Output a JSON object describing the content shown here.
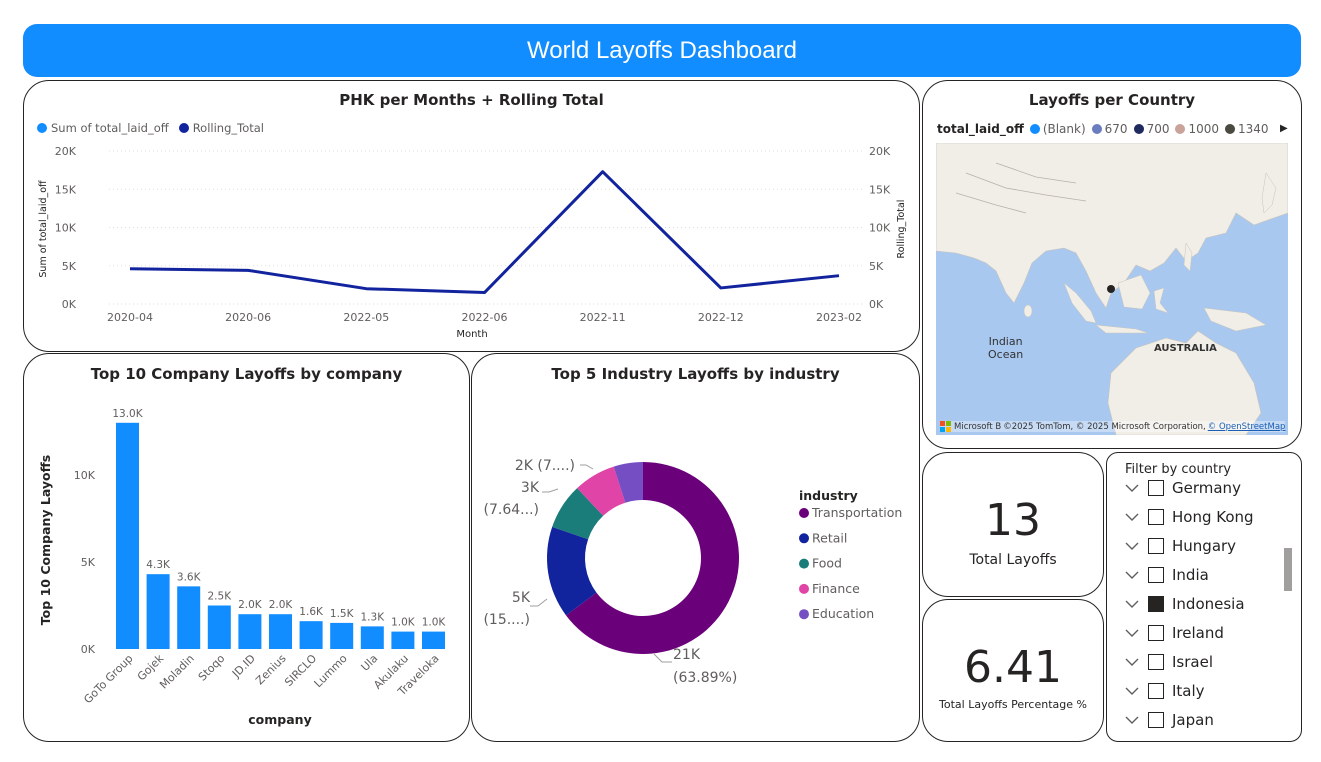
{
  "dashboard": {
    "title": "World Layoffs Dashboard"
  },
  "line_chart": {
    "title": "PHK per Months + Rolling Total",
    "legend": [
      {
        "label": "Sum of total_laid_off",
        "color": "#118dff"
      },
      {
        "label": "Rolling_Total",
        "color": "#12239e"
      }
    ],
    "y_ticks": [
      "20K",
      "15K",
      "10K",
      "5K",
      "0K"
    ],
    "y2_ticks": [
      "20K",
      "15K",
      "10K",
      "5K",
      "0K"
    ],
    "x_ticks": [
      "2020-04",
      "2020-06",
      "2022-05",
      "2022-06",
      "2022-11",
      "2022-12",
      "2023-02"
    ],
    "ylabel": "Sum of total_laid_off",
    "y2label": "Rolling_Total",
    "xlabel": "Month"
  },
  "map": {
    "title": "Layoffs per Country",
    "legend_title": "total_laid_off",
    "legend": [
      {
        "label": "(Blank)",
        "color": "#118dff"
      },
      {
        "label": "670",
        "color": "#6b7dbf"
      },
      {
        "label": "700",
        "color": "#1f2a5e"
      },
      {
        "label": "1000",
        "color": "#c9a39a"
      },
      {
        "label": "1340",
        "color": "#4a4a40"
      }
    ],
    "label_ocean_1": "Indian",
    "label_ocean_2": "Ocean",
    "label_australia": "AUSTRALIA",
    "attribution": "Microsoft B",
    "attribution_text": "©2025 TomTom, © 2025 Microsoft Corporation, ",
    "attribution_link": "© OpenStreetMap"
  },
  "bar_chart": {
    "title": "Top 10 Company Layoffs by company",
    "ylabel": "Top 10 Company Layoffs",
    "xlabel": "company",
    "y_ticks": [
      "10K",
      "5K",
      "0K"
    ]
  },
  "donut_chart": {
    "title": "Top 5 Industry Layoffs by industry",
    "legend_title": "industry",
    "labels": {
      "transport_1": "21K",
      "transport_2": "(63.89%)",
      "retail_1": "5K",
      "retail_2": "(15....)",
      "food_1": "3K",
      "food_2": "(7.64...)",
      "finance_1": "2K (7....)"
    }
  },
  "kpi_total": {
    "value": "13",
    "label": "Total Layoffs"
  },
  "kpi_percent": {
    "value": "6.41",
    "label": "Total Layoffs Percentage %"
  },
  "slicer": {
    "title": "Filter by country",
    "items": [
      {
        "label": "Germany",
        "checked": false
      },
      {
        "label": "Hong Kong",
        "checked": false
      },
      {
        "label": "Hungary",
        "checked": false
      },
      {
        "label": "India",
        "checked": false
      },
      {
        "label": "Indonesia",
        "checked": true
      },
      {
        "label": "Ireland",
        "checked": false
      },
      {
        "label": "Israel",
        "checked": false
      },
      {
        "label": "Italy",
        "checked": false
      },
      {
        "label": "Japan",
        "checked": false
      }
    ]
  },
  "chart_data": [
    {
      "type": "line",
      "title": "PHK per Months + Rolling Total",
      "x": [
        "2020-04",
        "2020-06",
        "2022-05",
        "2022-06",
        "2022-11",
        "2022-12",
        "2023-02"
      ],
      "series": [
        {
          "name": "Rolling_Total",
          "values": [
            4600,
            4400,
            2000,
            1500,
            17300,
            2100,
            3700
          ],
          "color": "#12239e"
        }
      ],
      "xlabel": "Month",
      "ylabel": "Sum of total_laid_off",
      "y2label": "Rolling_Total",
      "ylim": [
        0,
        20000
      ],
      "grid": true,
      "legend": "top-left"
    },
    {
      "type": "bar",
      "title": "Top 10 Company Layoffs by company",
      "categories": [
        "GoTo Group",
        "Gojek",
        "Moladin",
        "Stoqo",
        "JD.ID",
        "Zenius",
        "SIRCLO",
        "Lummo",
        "Ula",
        "Akulaku",
        "Traveloka"
      ],
      "values": [
        13000,
        4300,
        3600,
        2500,
        2000,
        2000,
        1600,
        1500,
        1300,
        1000,
        1000
      ],
      "data_labels": [
        "13.0K",
        "4.3K",
        "3.6K",
        "2.5K",
        "2.0K",
        "2.0K",
        "1.6K",
        "1.5K",
        "1.3K",
        "1.0K",
        "1.0K"
      ],
      "xlabel": "company",
      "ylabel": "Top 10 Company Layoffs",
      "ylim": [
        0,
        14000
      ],
      "color": "#118dff"
    },
    {
      "type": "pie",
      "title": "Top 5 Industry Layoffs by industry",
      "categories": [
        "Transportation",
        "Retail",
        "Food",
        "Finance",
        "Education"
      ],
      "values": [
        21000,
        5000,
        2500,
        2300,
        1600
      ],
      "percent": [
        63.89,
        15.3,
        7.64,
        7.1,
        6.07
      ],
      "colors": [
        "#6b007b",
        "#12239e",
        "#1b7d79",
        "#e044a7",
        "#744ec2"
      ],
      "legend": "right"
    }
  ]
}
